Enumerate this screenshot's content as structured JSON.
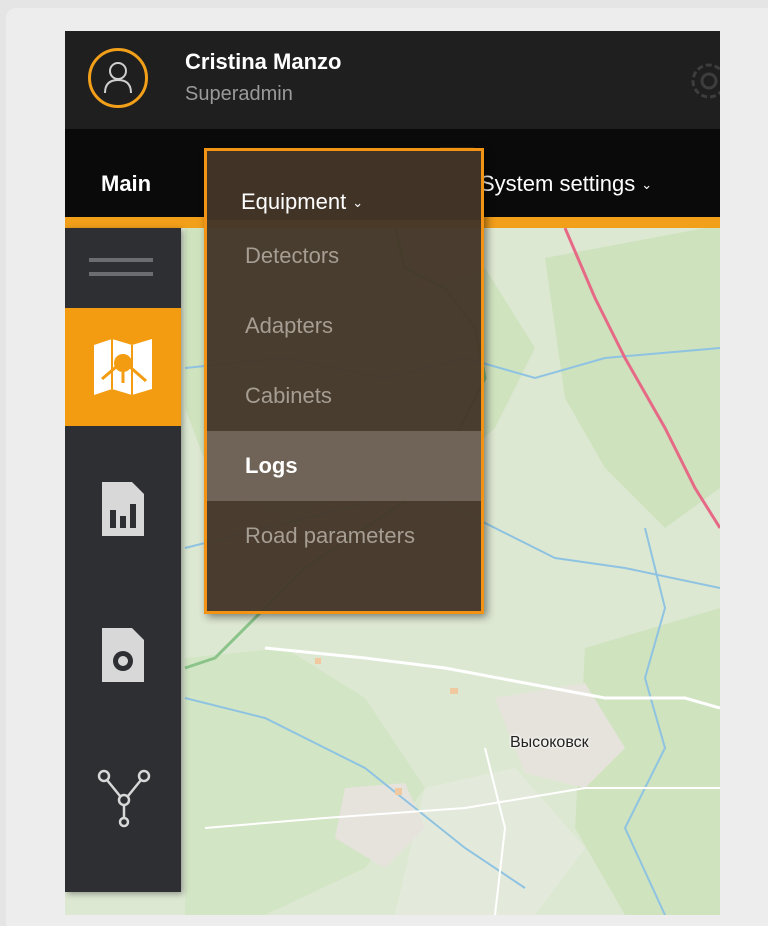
{
  "user": {
    "name": "Cristina Manzo",
    "role": "Superadmin"
  },
  "nav": {
    "main": "Main",
    "equipment": "Equipment",
    "system_settings": "System settings"
  },
  "dropdown": {
    "items": [
      "Detectors",
      "Adapters",
      "Cabinets",
      "Logs",
      "Road parameters"
    ],
    "active_index": 3
  },
  "sidebar": {
    "icons": [
      "menu-icon",
      "map-icon",
      "reports-icon",
      "camera-icon",
      "network-icon"
    ],
    "active": "map-icon"
  },
  "map": {
    "town_label": "Высоковск"
  },
  "colors": {
    "accent": "#f39c12",
    "header_bg": "#1f1f1f",
    "nav_bg": "#0a0a0a",
    "sidebar_bg": "#2e2f32",
    "dropdown_bg": "#443629"
  }
}
